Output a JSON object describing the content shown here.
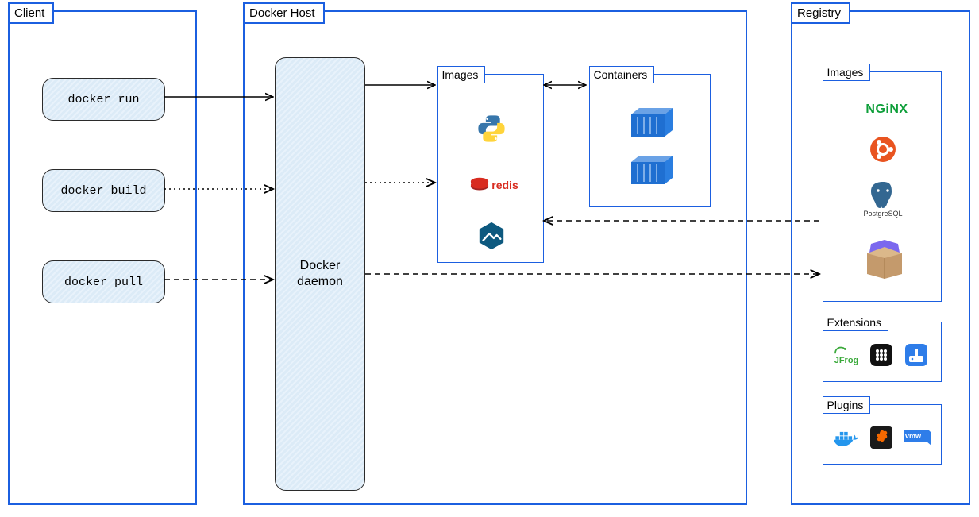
{
  "client": {
    "title": "Client",
    "commands": {
      "run": "docker run",
      "build": "docker build",
      "pull": "docker pull"
    }
  },
  "host": {
    "title": "Docker Host",
    "daemon_label": "Docker daemon",
    "images": {
      "title": "Images",
      "items": [
        "python",
        "redis",
        "alpine"
      ]
    },
    "containers": {
      "title": "Containers"
    }
  },
  "registry": {
    "title": "Registry",
    "images": {
      "title": "Images",
      "items": [
        "nginx",
        "ubuntu",
        "postgres",
        "package"
      ]
    },
    "extensions": {
      "title": "Extensions",
      "items": [
        "jfrog",
        "grid-app",
        "portainer"
      ]
    },
    "plugins": {
      "title": "Plugins",
      "items": [
        "docker",
        "grafana",
        "vmware"
      ]
    }
  },
  "labels": {
    "nginx": "NGiNX",
    "jfrog": "JFrog",
    "postgres": "PostgreSQL",
    "vmware": "vmw"
  }
}
